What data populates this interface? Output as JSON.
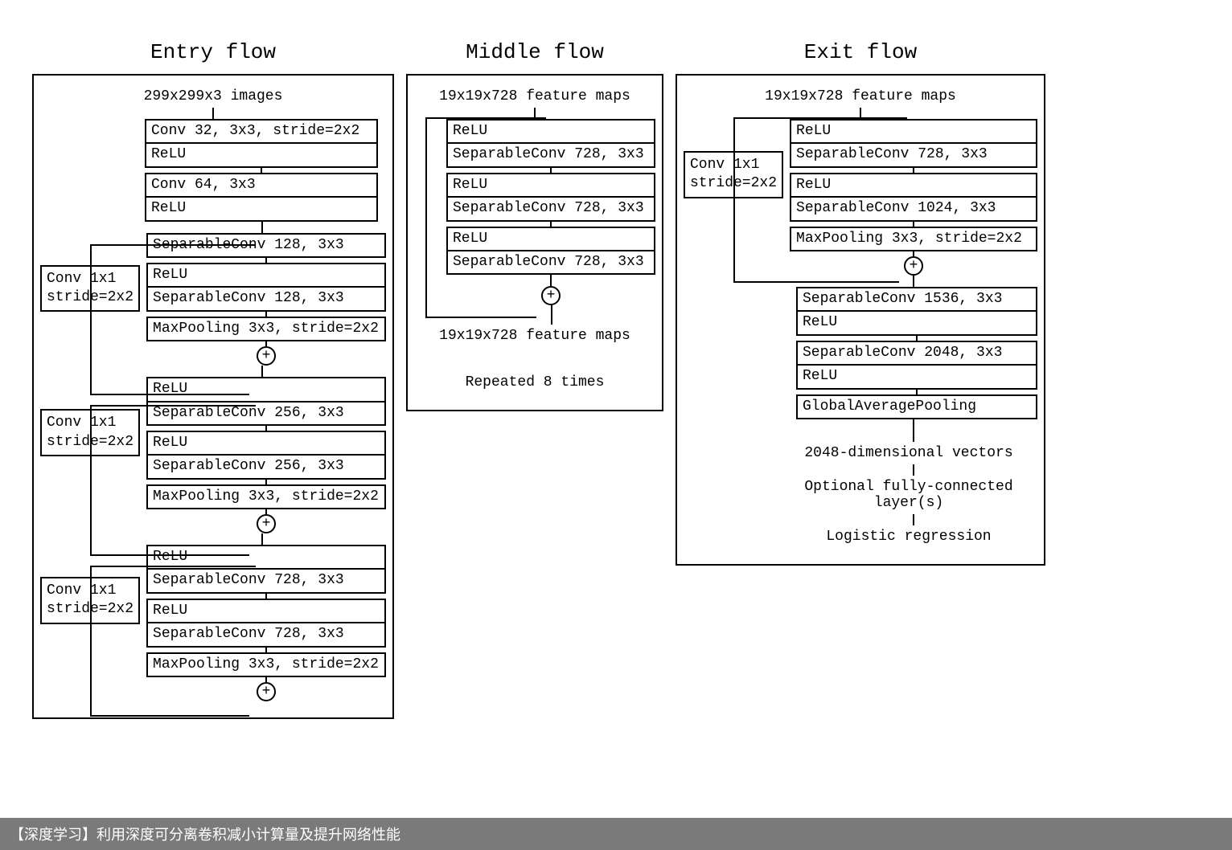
{
  "footer": "【深度学习】利用深度可分离卷积减小计算量及提升网络性能",
  "entry": {
    "title": "Entry flow",
    "input": "299x299x3 images",
    "stage0": {
      "l1": "Conv 32, 3x3, stride=2x2",
      "l2": "ReLU",
      "l3": "Conv 64, 3x3",
      "l4": "ReLU"
    },
    "block1": {
      "skip1": "Conv 1x1",
      "skip2": "stride=2x2",
      "a": "SeparableConv 128, 3x3",
      "b": "ReLU",
      "c": "SeparableConv 128, 3x3",
      "d": "MaxPooling 3x3, stride=2x2"
    },
    "block2": {
      "skip1": "Conv 1x1",
      "skip2": "stride=2x2",
      "a": "ReLU",
      "b": "SeparableConv 256, 3x3",
      "c": "ReLU",
      "d": "SeparableConv 256, 3x3",
      "e": "MaxPooling 3x3, stride=2x2"
    },
    "block3": {
      "skip1": "Conv 1x1",
      "skip2": "stride=2x2",
      "a": "ReLU",
      "b": "SeparableConv 728, 3x3",
      "c": "ReLU",
      "d": "SeparableConv 728, 3x3",
      "e": "MaxPooling 3x3, stride=2x2"
    }
  },
  "middle": {
    "title": "Middle flow",
    "input": "19x19x728 feature maps",
    "block": {
      "a": "ReLU",
      "b": "SeparableConv 728, 3x3",
      "c": "ReLU",
      "d": "SeparableConv 728, 3x3",
      "e": "ReLU",
      "f": "SeparableConv 728, 3x3"
    },
    "output": "19x19x728 feature maps",
    "repeat": "Repeated 8 times"
  },
  "exit": {
    "title": "Exit flow",
    "input": "19x19x728 feature maps",
    "block1": {
      "skip1": "Conv 1x1",
      "skip2": "stride=2x2",
      "a": "ReLU",
      "b": "SeparableConv 728, 3x3",
      "c": "ReLU",
      "d": "SeparableConv 1024, 3x3",
      "e": "MaxPooling 3x3, stride=2x2"
    },
    "post": {
      "a": "SeparableConv 1536, 3x3",
      "b": "ReLU",
      "c": "SeparableConv 2048, 3x3",
      "d": "ReLU",
      "e": "GlobalAveragePooling"
    },
    "tail": {
      "a": "2048-dimensional vectors",
      "b": "Optional fully-connected layer(s)",
      "c": "Logistic regression"
    }
  },
  "plus": "+"
}
